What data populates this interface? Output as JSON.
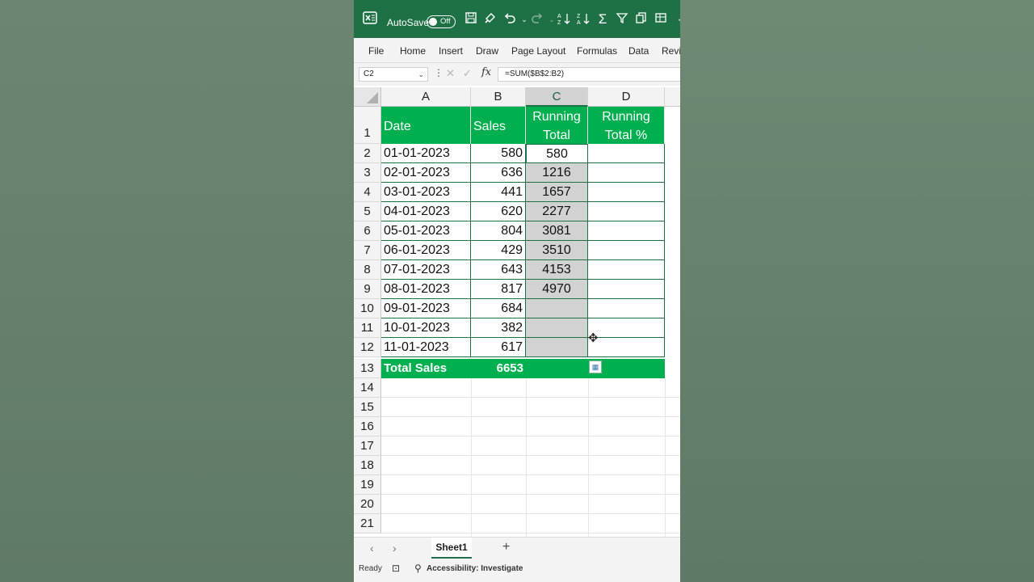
{
  "titlebar": {
    "autosave_label": "AutoSave",
    "autosave_state": "Off",
    "icons": [
      "excel-logo-icon",
      "save-icon",
      "format-painter-icon",
      "undo-icon",
      "redo-icon",
      "sort-ascending-icon",
      "sort-descending-icon",
      "autosum-icon",
      "filter-icon",
      "copy-icon",
      "table-icon"
    ]
  },
  "ribbon": {
    "tabs": [
      "File",
      "Home",
      "Insert",
      "Draw",
      "Page Layout",
      "Formulas",
      "Data",
      "Revi"
    ]
  },
  "formula_bar": {
    "name_box": "C2",
    "formula": "=SUM($B$2:B2)",
    "fx_label": "fx"
  },
  "columns": [
    "A",
    "B",
    "C",
    "D"
  ],
  "header_row": {
    "date": "Date",
    "sales": "Sales",
    "running_total_1": "Running",
    "running_total_2": "Total",
    "running_pct_1": "Running",
    "running_pct_2": "Total %"
  },
  "rows": [
    {
      "num": "2",
      "date": "01-01-2023",
      "sales": "580",
      "running": "580"
    },
    {
      "num": "3",
      "date": "02-01-2023",
      "sales": "636",
      "running": "1216"
    },
    {
      "num": "4",
      "date": "03-01-2023",
      "sales": "441",
      "running": "1657"
    },
    {
      "num": "5",
      "date": "04-01-2023",
      "sales": "620",
      "running": "2277"
    },
    {
      "num": "6",
      "date": "05-01-2023",
      "sales": "804",
      "running": "3081"
    },
    {
      "num": "7",
      "date": "06-01-2023",
      "sales": "429",
      "running": "3510"
    },
    {
      "num": "8",
      "date": "07-01-2023",
      "sales": "643",
      "running": "4153"
    },
    {
      "num": "9",
      "date": "08-01-2023",
      "sales": "817",
      "running": "4970"
    },
    {
      "num": "10",
      "date": "09-01-2023",
      "sales": "684",
      "running": ""
    },
    {
      "num": "11",
      "date": "10-01-2023",
      "sales": "382",
      "running": ""
    },
    {
      "num": "12",
      "date": "11-01-2023",
      "sales": "617",
      "running": ""
    }
  ],
  "total_row": {
    "num": "13",
    "label": "Total Sales",
    "value": "6653"
  },
  "empty_rows": [
    "1",
    "14",
    "15",
    "16",
    "17",
    "18",
    "19",
    "20",
    "21"
  ],
  "sheet_tabs": {
    "active": "Sheet1",
    "add": "+"
  },
  "status": {
    "ready": "Ready",
    "accessibility": "Accessibility: Investigate"
  },
  "colors": {
    "header_green": "#00b050",
    "title_green": "#1e7145",
    "selection_gray": "#d2d2d2"
  }
}
